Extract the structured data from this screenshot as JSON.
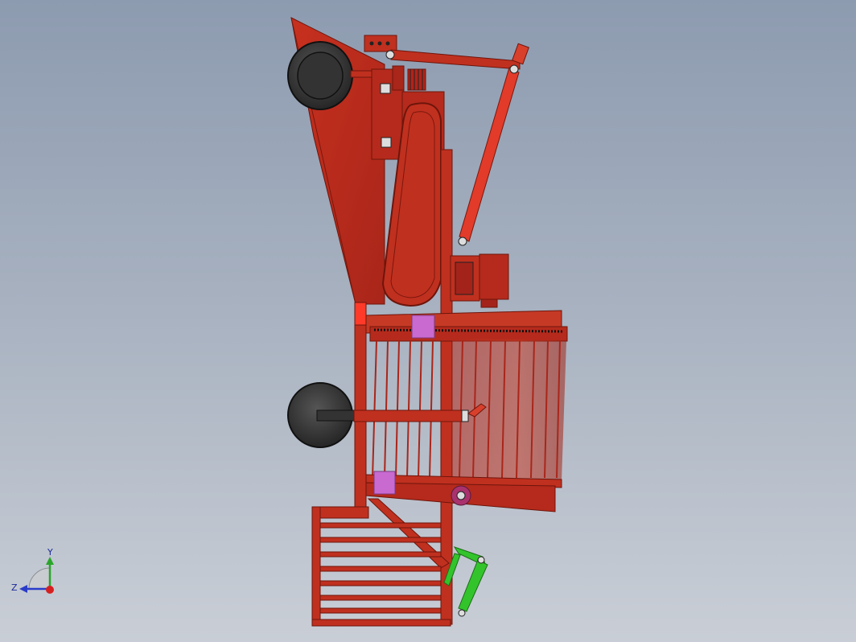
{
  "viewport": {
    "background_top": "#8d9bb0",
    "background_bottom": "#c9ced6"
  },
  "model": {
    "frame_color": "#c0301f",
    "frame_dark": "#8e1d10",
    "cylinder_color": "#e23b2a",
    "wheel_color": "#3a3a3a",
    "drum_pink": "#c86ad0",
    "green_link": "#33c42c"
  },
  "triad": {
    "y_label": "Y",
    "z_label": "Z"
  }
}
